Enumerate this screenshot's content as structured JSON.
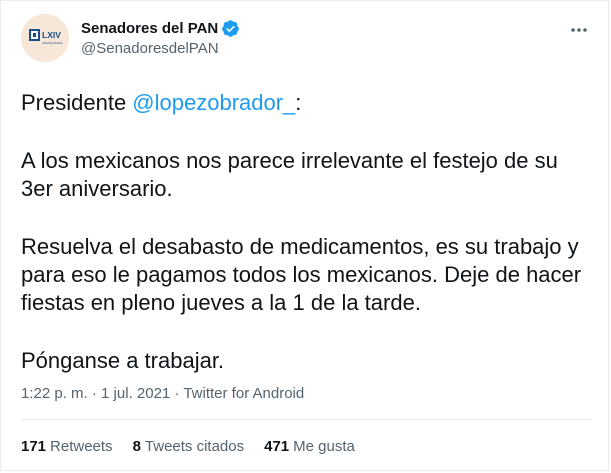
{
  "author": {
    "display_name": "Senadores del PAN",
    "handle": "@SenadoresdelPAN",
    "avatar": {
      "text_top": "LXIV",
      "text_bottom": "LEGISLATURA",
      "icon": "senate-logo-icon"
    },
    "verified_icon": "verified-badge-icon"
  },
  "more_icon": "more-options-icon",
  "tweet": {
    "line1_prefix": "Presidente ",
    "mention": "@lopezobrador_",
    "line1_suffix": ":",
    "para2": "A los mexicanos nos parece irrelevante el festejo de su 3er aniversario.",
    "para3": "Resuelva el desabasto de medicamentos, es su trabajo y para eso le pagamos todos los mexicanos. Deje de hacer fiestas en pleno jueves a la 1 de la tarde.",
    "para4": "Pónganse a trabajar."
  },
  "meta": {
    "time": "1:22 p. m.",
    "separator": " · ",
    "date": "1 jul. 2021",
    "source": "Twitter for Android"
  },
  "stats": [
    {
      "count": "171",
      "label": "Retweets"
    },
    {
      "count": "8",
      "label": "Tweets citados"
    },
    {
      "count": "471",
      "label": "Me gusta"
    }
  ],
  "colors": {
    "text": "#0f1419",
    "secondary": "#536471",
    "accent": "#1d9bf0",
    "avatar_bg": "#f7e7d8",
    "logo_blue": "#1a4d8f"
  }
}
